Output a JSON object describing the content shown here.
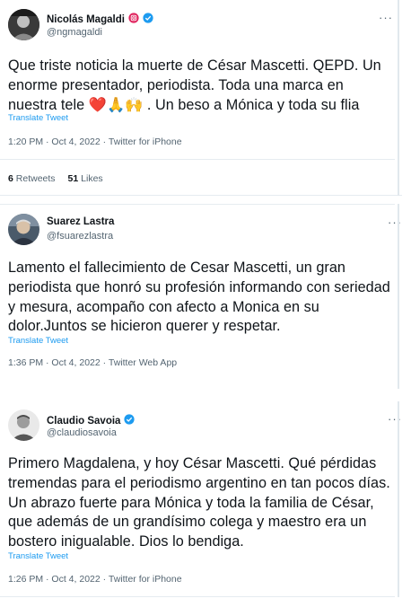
{
  "tweets": [
    {
      "display_name": "Nicolás Magaldi",
      "handle": "@ngmagaldi",
      "text": "Que triste noticia la muerte de César Mascetti. QEPD. Un enorme presentador, periodista. Toda una marca en nuestra tele ❤️🙏🙌 . Un beso a Mónica y toda su flia",
      "translate": "Translate Tweet",
      "meta": "1:20 PM · Oct 4, 2022 · Twitter for iPhone",
      "retweets_count": "6",
      "retweets_label": "Retweets",
      "likes_count": "51",
      "likes_label": "Likes"
    },
    {
      "display_name": "Suarez Lastra",
      "handle": "@fsuarezlastra",
      "text": "Lamento el fallecimiento de Cesar Mascetti, un gran periodista que honró su profesión informando con seriedad y mesura, acompaño con afecto a Monica en su dolor.Juntos se hicieron querer y respetar.",
      "translate": "Translate Tweet",
      "meta": "1:36 PM · Oct 4, 2022 · Twitter Web App"
    },
    {
      "display_name": "Claudio Savoia",
      "handle": "@claudiosavoia",
      "text": "Primero Magdalena, y hoy César Mascetti. Qué pérdidas tremendas para el periodismo argentino en tan pocos días. Un abrazo fuerte para Mónica y toda la familia de César, que además de un grandísimo colega y maestro era un bostero inigualable. Dios lo bendiga.",
      "translate": "Translate Tweet",
      "meta": "1:26 PM · Oct 4, 2022 · Twitter for iPhone"
    }
  ],
  "more_glyph": "···",
  "verified_color": "#1d9bf0",
  "link_color": "#1d9bf0"
}
